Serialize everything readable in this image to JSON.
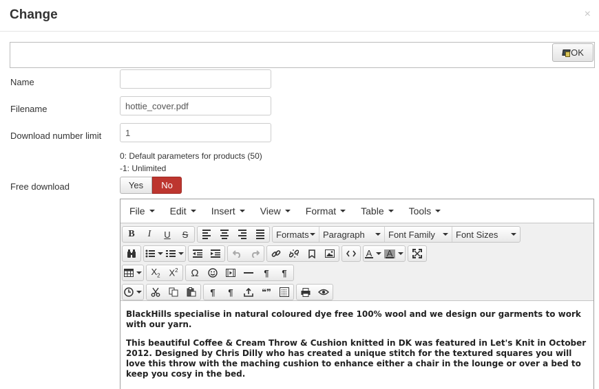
{
  "modal": {
    "title": "Change",
    "close_glyph": "×",
    "ok_label": "OK"
  },
  "form": {
    "name_label": "Name",
    "name_value": "",
    "filename_label": "Filename",
    "filename_value": "hottie_cover.pdf",
    "limit_label": "Download number limit",
    "limit_value": "1",
    "limit_hint_1": "0: Default parameters for products (50)",
    "limit_hint_2": "-1: Unlimited",
    "free_label": "Free download",
    "free_yes": "Yes",
    "free_no": "No",
    "free_selected": "No"
  },
  "editor": {
    "menus": [
      "File",
      "Edit",
      "Insert",
      "View",
      "Format",
      "Table",
      "Tools"
    ],
    "formats_label": "Formats",
    "paragraph_label": "Paragraph",
    "font_family_label": "Font Family",
    "font_sizes_label": "Font Sizes",
    "glyphs": {
      "bold": "B",
      "italic": "I",
      "underline": "U",
      "strike": "S",
      "text_color": "A",
      "bg_color": "A",
      "subscript": "X",
      "subscript_mark": "2",
      "superscript": "X",
      "superscript_mark": "2",
      "omega": "Ω",
      "pilcrow": "¶",
      "quote": "❝❞"
    },
    "content_paragraphs": [
      "BlackHills specialise in natural coloured dye free 100% wool and we design our garments to work with our yarn.",
      "This beautiful Coffee & Cream Throw & Cushion knitted in DK was featured in Let's Knit in October 2012. Designed by Chris Dilly who has created a unique stitch for the textured squares you will love this throw with the maching cushion to enhance either a chair in the lounge or over a bed to keep you cosy in the bed."
    ]
  },
  "icons": [
    "close-icon",
    "ok-icon",
    "bold-icon",
    "italic-icon",
    "underline-icon",
    "strikethrough-icon",
    "align-left-icon",
    "align-center-icon",
    "align-right-icon",
    "align-justify-icon",
    "binoculars-icon",
    "bullet-list-icon",
    "numbered-list-icon",
    "outdent-icon",
    "indent-icon",
    "undo-icon",
    "redo-icon",
    "link-icon",
    "unlink-icon",
    "bookmark-icon",
    "image-icon",
    "code-icon",
    "text-color-icon",
    "background-color-icon",
    "fullscreen-icon",
    "table-icon",
    "subscript-icon",
    "superscript-icon",
    "omega-icon",
    "smiley-icon",
    "media-icon",
    "horizontal-rule-icon",
    "ltr-icon",
    "rtl-icon",
    "clock-icon",
    "cut-icon",
    "copy-icon",
    "paste-icon",
    "pilcrow-icon",
    "insert-icon",
    "quote-icon",
    "template-icon",
    "print-icon",
    "preview-icon"
  ]
}
